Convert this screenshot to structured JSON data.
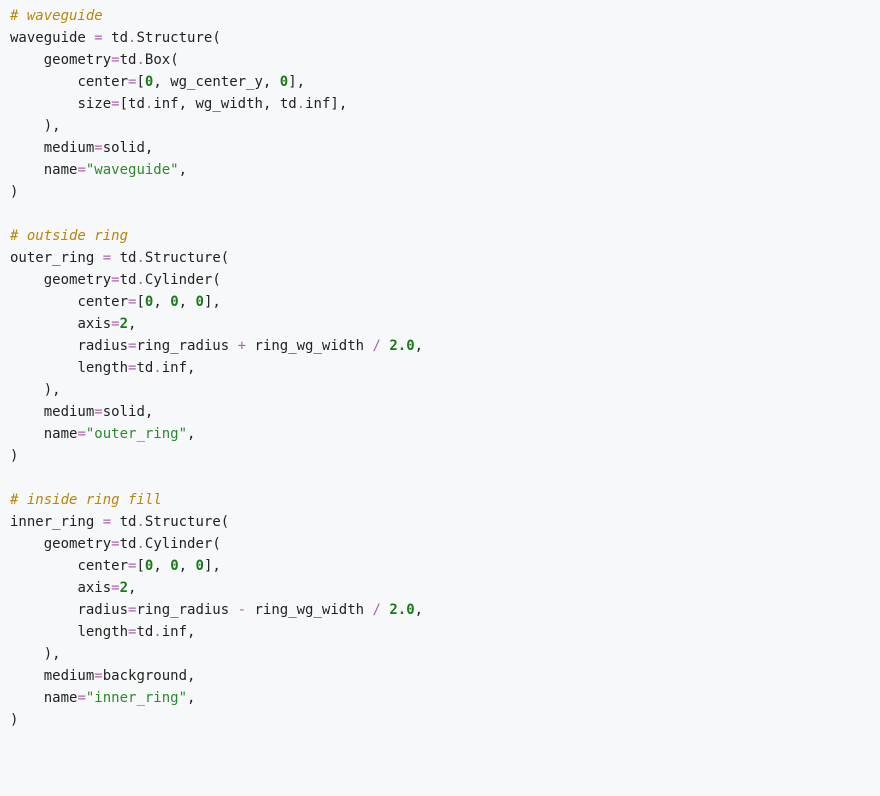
{
  "code": {
    "c_waveguide": "# waveguide",
    "waveguide_var": "waveguide",
    "td": "td",
    "Structure": "Structure",
    "Box": "Box",
    "Cylinder": "Cylinder",
    "geometry_kw": "geometry",
    "center_kw": "center",
    "size_kw": "size",
    "axis_kw": "axis",
    "radius_kw": "radius",
    "length_kw": "length",
    "medium_kw": "medium",
    "name_kw": "name",
    "zero": "0",
    "two": "2",
    "two_point_zero": "2.0",
    "wg_center_y": "wg_center_y",
    "wg_width": "wg_width",
    "inf": "inf",
    "solid": "solid",
    "background": "background",
    "ring_radius": "ring_radius",
    "ring_wg_width": "ring_wg_width",
    "s_waveguide": "\"waveguide\"",
    "c_outside_ring": "# outside ring",
    "outer_ring_var": "outer_ring",
    "s_outer_ring": "\"outer_ring\"",
    "c_inside_ring": "# inside ring fill",
    "inner_ring_var": "inner_ring",
    "s_inner_ring": "\"inner_ring\"",
    "eq": "=",
    "dot": ".",
    "comma": ",",
    "lparen": "(",
    "rparen": ")",
    "lbrack": "[",
    "rbrack": "]",
    "plus": "+",
    "minus": "-",
    "slash": "/"
  }
}
